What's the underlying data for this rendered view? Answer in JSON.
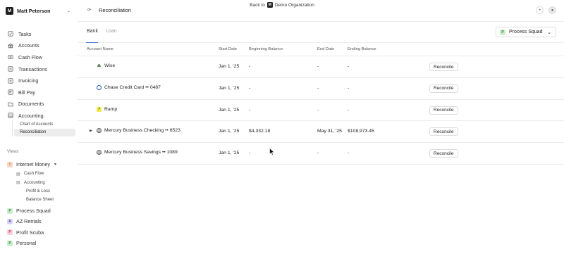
{
  "banner": {
    "prefix": "Back to",
    "org": "Demo Organization",
    "icon": "org-logo-icon"
  },
  "org": {
    "name": "Matt Peterson",
    "logo_letter": "M"
  },
  "nav": {
    "items": [
      {
        "label": "Tasks",
        "icon": "tasks-icon"
      },
      {
        "label": "Accounts",
        "icon": "accounts-icon"
      },
      {
        "label": "Cash Flow",
        "icon": "cash-flow-icon"
      },
      {
        "label": "Transactions",
        "icon": "transactions-icon"
      },
      {
        "label": "Invoicing",
        "icon": "invoicing-icon"
      },
      {
        "label": "Bill Pay",
        "icon": "bill-pay-icon"
      },
      {
        "label": "Documents",
        "icon": "documents-icon"
      },
      {
        "label": "Accounting",
        "icon": "accounting-icon"
      }
    ],
    "sub": [
      {
        "label": "Chart of Accounts"
      },
      {
        "label": "Reconciliation",
        "active": true
      }
    ]
  },
  "views": {
    "label": "Views",
    "groups": [
      {
        "label": "Internet Money",
        "badge": "I",
        "color": "#f6d7c5",
        "text_color": "#c0562a"
      }
    ],
    "sub": [
      {
        "label": "Cash Flow",
        "icon": "chart-icon"
      },
      {
        "label": "Accounting",
        "icon": "ledger-icon"
      },
      {
        "label": "Profit & Loss"
      },
      {
        "label": "Balance Sheet"
      }
    ],
    "others": [
      {
        "label": "Process Squad",
        "badge": "P",
        "color": "#cdeccd",
        "text_color": "#2f8a3a"
      },
      {
        "label": "AZ Rentals",
        "badge": "A",
        "color": "#d8d6f4",
        "text_color": "#4b45a8"
      },
      {
        "label": "Profit Scuba",
        "badge": "P",
        "color": "#f6d0d6",
        "text_color": "#c03a4f"
      },
      {
        "label": "Personal",
        "badge": "P",
        "color": "#cdeccd",
        "text_color": "#2f8a3a"
      }
    ]
  },
  "header": {
    "title": "Reconciliation",
    "plus": "+",
    "avatar_icon": "avatar-icon"
  },
  "tabs": [
    {
      "label": "Bank",
      "active": true
    },
    {
      "label": "Loan"
    }
  ],
  "squad_select": {
    "badge": "P",
    "value": "Process Squad"
  },
  "table": {
    "columns": [
      "Account Name",
      "Start Date",
      "Beginning Balance",
      "End Date",
      "Ending Balance"
    ],
    "button_label": "Reconcile",
    "rows": [
      {
        "name": "Wise",
        "icon": "wise-icon",
        "start": "Jan 1, '25",
        "begin": "-",
        "end": "-",
        "ending": "-",
        "expandable": false
      },
      {
        "name": "Chase Credit Card •• 0487",
        "icon": "chase-icon",
        "start": "Jan 1, '25",
        "begin": "-",
        "end": "-",
        "ending": "-",
        "expandable": false
      },
      {
        "name": "Ramp",
        "icon": "ramp-icon",
        "start": "Jan 1, '25",
        "begin": "-",
        "end": "-",
        "ending": "-",
        "expandable": false
      },
      {
        "name": "Mercury Business Checking •• 8523",
        "icon": "mercury-icon",
        "start": "Jan 1, '25",
        "begin": "$4,332.18",
        "end": "May 31, '25",
        "ending": "$108,973.45",
        "expandable": true
      },
      {
        "name": "Mercury Business Savings •• 1089",
        "icon": "mercury-icon",
        "start": "Jan 1, '25",
        "begin": "-",
        "end": "-",
        "ending": "-",
        "expandable": false
      }
    ]
  }
}
